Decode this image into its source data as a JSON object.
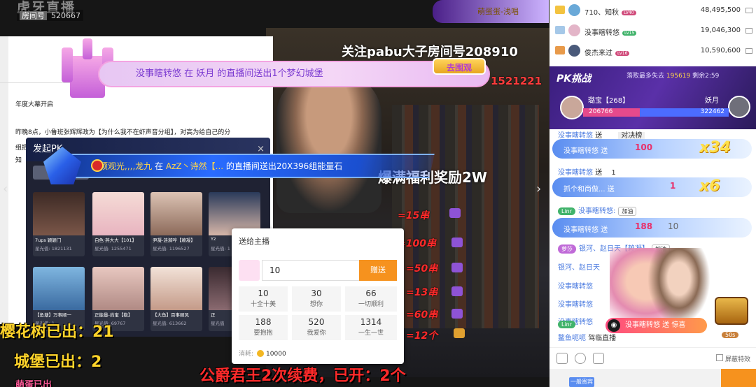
{
  "stream": {
    "logo_text": "虎牙直播",
    "room_id_label": "房间号",
    "room_id": "520667",
    "top_right_text": "萌蛋蛋-浅唱",
    "follow_text": "关注pabu大子房间号208910",
    "red_number": "1521221",
    "reward_text": "爆满福利奖励2W",
    "doc_line1": "年度大幕开启",
    "doc_line2": "昨晚8点，小鲁班张辉辉政为【为什么我不在虾声音分组】，对高为给自己的分",
    "doc_line3": "组把",
    "doc_line4": "知",
    "castle_banner": "没事瞎转悠 在 妖月 的直播间送出1个梦幻城堡",
    "castle_tag": "去围观",
    "gift_banner_user": "山顶观光,,,,龙九",
    "gift_banner_mid": " 在 ",
    "gift_banner_target": "AzZ丶诗然【...",
    "gift_banner_rest": " 的直播间送出20X396组能量石",
    "pk_panel_title": "发起PK",
    "cards": [
      {
        "name": "7ups 颖颖门",
        "stars": "星光值: 1821131"
      },
      {
        "name": "白色·燕大大【101】",
        "stars": "星光值: 1255471"
      },
      {
        "name": "尹凝-涟漪哼【赖凝】",
        "stars": "星光值: 1196527"
      },
      {
        "name": "Yz",
        "stars": "星光值: 1"
      },
      {
        "name": "【鱼塘】万事顺一",
        "stars": "星光值: 1"
      },
      {
        "name": "正能量-尚宝【稳】",
        "stars": "星光值: 69767"
      },
      {
        "name": "【大鱼】百事顺风",
        "stars": "星光值: 613662"
      },
      {
        "name": "正",
        "stars": "星光值"
      }
    ],
    "red_counts": [
      "=15串",
      "=100串",
      "=50串",
      "=13串",
      "=60串",
      "=12个"
    ],
    "sakura_text": "樱花树已出：21",
    "castle_text": "城堡已出：2",
    "promo_text": "公爵君王2次续费，已开：2个",
    "bottom_left_text": "萌蛋已出"
  },
  "send_panel": {
    "title": "送给主播",
    "quantity": "10",
    "send_button": "赠送",
    "options": [
      {
        "num": "10",
        "desc": "十全十美"
      },
      {
        "num": "30",
        "desc": "想你"
      },
      {
        "num": "66",
        "desc": "一切顺利"
      },
      {
        "num": "188",
        "desc": "要抱抱"
      },
      {
        "num": "520",
        "desc": "我爱你"
      },
      {
        "num": "1314",
        "desc": "一生一世"
      }
    ],
    "cost_label": "消耗:",
    "cost_value": "10000"
  },
  "rank": [
    {
      "name": "710、知秋",
      "level": "LV40",
      "value": "48,495,500"
    },
    {
      "name": "没事瞎转悠",
      "level": "LV15",
      "value": "19,046,300"
    },
    {
      "name": "俊杰来过",
      "level": "LV16",
      "value": "10,590,600"
    }
  ],
  "pk": {
    "label": "PK挑战",
    "info_prefix": "落败最多失去",
    "info_value": "195619",
    "info_suffix": "剩余2:59",
    "left_name": "璐宝【268】",
    "left_score": "206766",
    "right_name": "妖月",
    "right_score": "322462",
    "left_ratio": 0.39
  },
  "chat": {
    "line1_user": "没事瞎转悠",
    "line1_mid": "送",
    "line1_tab": "对决榜",
    "gift1_user": "没事瞎转悠",
    "gift1_send": "送",
    "gift1_count": "100",
    "gift1_mult": "x34",
    "line2_user": "没事瞎转悠",
    "line2_mid": "送",
    "line2_count": "1",
    "gift2_user": "抓个和尚做...",
    "gift2_send": "送",
    "gift2_count": "1",
    "gift2_mult": "x6",
    "line3_badge": "Linr",
    "line3_user": "没事瞎转悠:",
    "line3_pill": "加油",
    "gift3_user": "没事瞎转悠",
    "gift3_send": "送",
    "gift3_count": "188",
    "gift3_tail": "10",
    "line4_badge": "萝莎",
    "line4_user": "银河、赵日天【赖凝】",
    "line4_pill": "加油",
    "line5": "银河、赵日天",
    "line6": "没事瞎转悠",
    "line7": "没事瞎转悠",
    "line8": "没事瞎转悠",
    "line9_badge": "Linr",
    "line10": "鳌鱼呃呃",
    "line10_tail": "驾临直播",
    "invite_text": "没事瞎转悠 送 惊喜",
    "chest_timer": "50s",
    "shield_label": "屏蔽特效",
    "bottom_chip": "一般贵宾"
  }
}
